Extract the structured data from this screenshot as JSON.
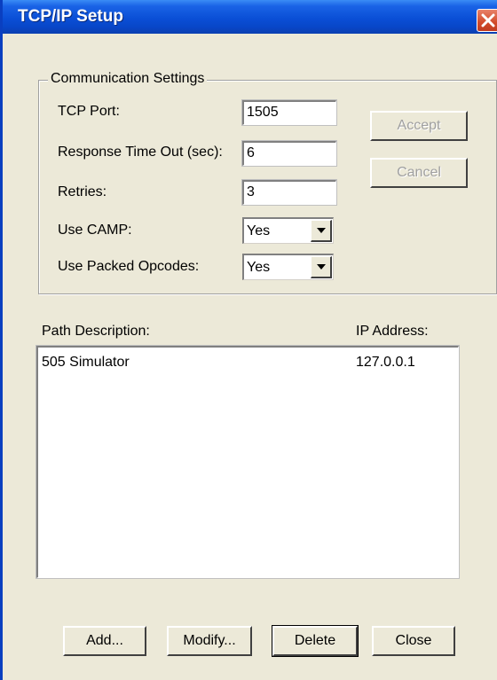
{
  "window": {
    "title": "TCP/IP Setup"
  },
  "group": {
    "label": "Communication Settings",
    "tcp_port_label": "TCP Port:",
    "tcp_port_value": "1505",
    "timeout_label": "Response Time Out (sec):",
    "timeout_value": "6",
    "retries_label": "Retries:",
    "retries_value": "3",
    "camp_label": "Use CAMP:",
    "camp_value": "Yes",
    "packed_label": "Use Packed Opcodes:",
    "packed_value": "Yes"
  },
  "side_buttons": {
    "accept": "Accept",
    "cancel": "Cancel"
  },
  "paths": {
    "col_desc": "Path Description:",
    "col_ip": "IP Address:",
    "rows": [
      {
        "desc": "505 Simulator",
        "ip": "127.0.0.1"
      }
    ]
  },
  "footer": {
    "add": "Add...",
    "modify": "Modify...",
    "delete": "Delete",
    "close": "Close"
  }
}
